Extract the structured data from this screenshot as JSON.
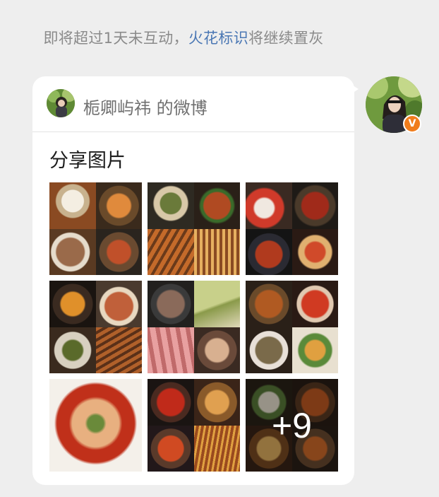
{
  "notice": {
    "prefix": "即将超过1天未互动，",
    "highlight": "火花标识",
    "suffix": "将继续置灰"
  },
  "card": {
    "source": "栀卿屿祎 的微博",
    "text": "分享图片",
    "more_count": "+9"
  },
  "photos": [
    {
      "name": "photo-1",
      "label": "noodles-and-skewers"
    },
    {
      "name": "photo-2",
      "label": "bbq-skewers"
    },
    {
      "name": "photo-3",
      "label": "hotpot-sashimi"
    },
    {
      "name": "photo-4",
      "label": "grilled-dishes"
    },
    {
      "name": "photo-5",
      "label": "meat-and-cake"
    },
    {
      "name": "photo-6",
      "label": "spicy-dishes"
    },
    {
      "name": "photo-7",
      "label": "spicy-dumplings"
    },
    {
      "name": "photo-8",
      "label": "hotpot-meal"
    },
    {
      "name": "photo-9",
      "label": "more-photos"
    }
  ],
  "colors": {
    "notice_text": "#8a8a8a",
    "notice_highlight": "#4a77b4",
    "badge": "#f07d1c",
    "background": "#eeeeee",
    "bubble": "#ffffff"
  },
  "icons": {
    "vip_badge": "v-badge-icon",
    "vip_badge_letter": "V"
  }
}
